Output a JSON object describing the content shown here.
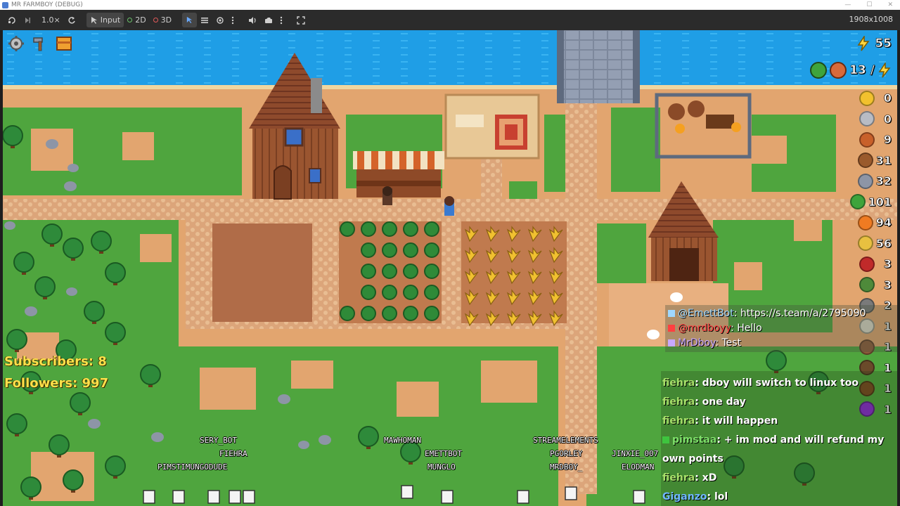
{
  "window": {
    "title": "MR FARMBOY (DEBUG)",
    "minimize": "—",
    "maximize": "☐",
    "close": "✕"
  },
  "toolbar": {
    "zoom": "1.0×",
    "input_label": "Input",
    "mode_2d": "2D",
    "mode_3d": "3D",
    "resolution": "1908x1008"
  },
  "hud": {
    "energy": "55",
    "population": "13 /",
    "subscribers": "Subscribers: 8",
    "followers": "Followers: 997"
  },
  "resources": [
    {
      "icon": "gold-coin-icon",
      "value": "0",
      "color": "#f2c12e"
    },
    {
      "icon": "silver-coin-icon",
      "value": "0",
      "color": "#b8bcc4"
    },
    {
      "icon": "copper-coin-icon",
      "value": "9",
      "color": "#c8602a"
    },
    {
      "icon": "wood-log-icon",
      "value": "31",
      "color": "#9a5a2c"
    },
    {
      "icon": "stone-icon",
      "value": "32",
      "color": "#8d95a6"
    },
    {
      "icon": "cabbage-icon",
      "value": "101",
      "color": "#3ea43b"
    },
    {
      "icon": "carrot-icon",
      "value": "94",
      "color": "#ef7b22"
    },
    {
      "icon": "wheat-icon",
      "value": "56",
      "color": "#e8c040"
    },
    {
      "icon": "meat-icon",
      "value": "3",
      "color": "#c02a2a"
    },
    {
      "icon": "branch-icon",
      "value": "3",
      "color": "#4e8a3a"
    },
    {
      "icon": "pickaxe-icon",
      "value": "2",
      "color": "#7a7a7a"
    },
    {
      "icon": "egg-icon",
      "value": "1",
      "color": "#e0dccd"
    },
    {
      "icon": "leather-icon",
      "value": "1",
      "color": "#8e5a3a"
    },
    {
      "icon": "tool-icon",
      "value": "1",
      "color": "#6a4a2a"
    },
    {
      "icon": "seed-icon",
      "value": "1",
      "color": "#7a4a20"
    },
    {
      "icon": "potion-icon",
      "value": "1",
      "color": "#8a2ad0"
    }
  ],
  "chat_top": [
    {
      "user": "@EmettBot",
      "message": ": https://s.team/a/2795090",
      "color": "#9fd8ff"
    },
    {
      "user": "@mrdboyy",
      "message": ": Hello",
      "color": "#ff4040"
    },
    {
      "user": "MrDboy",
      "message": ": Test",
      "color": "#c8a8ff"
    }
  ],
  "chat_bottom": [
    {
      "user": "fiehra",
      "message": ":  dboy will switch to linux too"
    },
    {
      "user": "fiehra",
      "message": ":  one day"
    },
    {
      "user": "fiehra",
      "message": ":  it will happen"
    },
    {
      "user": "pimstaa",
      "message": ":  + im mod and will refund my own points"
    },
    {
      "user": "fiehra",
      "message": ":  xD"
    },
    {
      "user": "Giganzo",
      "message": ":  lol"
    }
  ],
  "viewers": [
    {
      "name": "SERY_BOT"
    },
    {
      "name": "FIEHRA"
    },
    {
      "name": "PIMSTIMUNGODUDE"
    },
    {
      "name": "MAWHOMAN"
    },
    {
      "name": "EMETTBOT"
    },
    {
      "name": "MUNGLO"
    },
    {
      "name": "STREAMELEMENTS"
    },
    {
      "name": "PGORLEY"
    },
    {
      "name": "MRDBOY_"
    },
    {
      "name": "JINXIE_007"
    },
    {
      "name": "ELODMAN"
    }
  ]
}
